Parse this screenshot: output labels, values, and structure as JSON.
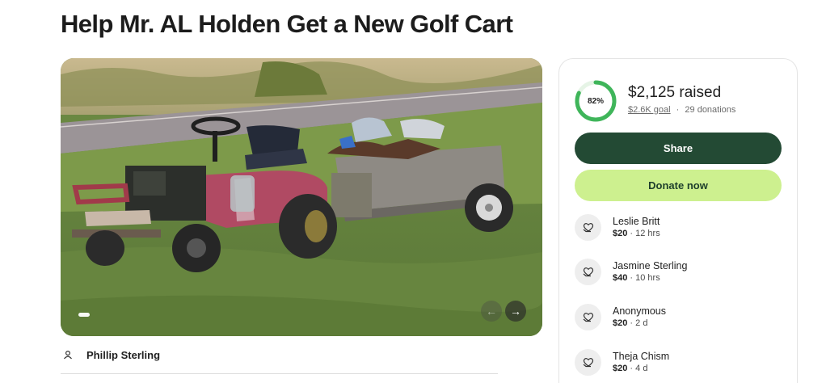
{
  "campaign": {
    "title": "Help Mr. AL Holden Get a New Golf Cart",
    "organizer": "Phillip Sterling"
  },
  "carousel": {
    "prev_icon": "←",
    "next_icon": "→",
    "slide_count_visible": 1
  },
  "progress": {
    "percent_label": "82%",
    "percent_value": 82,
    "raised": "$2,125 raised",
    "goal": "$2.6K goal",
    "separator": "·",
    "donations": "29 donations"
  },
  "actions": {
    "share_label": "Share",
    "donate_label": "Donate now"
  },
  "donations": [
    {
      "name": "Leslie Britt",
      "amount": "$20",
      "time": "12 hrs"
    },
    {
      "name": "Jasmine Sterling",
      "amount": "$40",
      "time": "10 hrs"
    },
    {
      "name": "Anonymous",
      "amount": "$20",
      "time": "2 d"
    },
    {
      "name": "Theja Chism",
      "amount": "$20",
      "time": "4 d"
    }
  ],
  "colors": {
    "brand_dark": "#234a34",
    "brand_light": "#cdf08f",
    "progress": "#3fb55a"
  },
  "icons": {
    "organizer": "person-icon",
    "donation": "heart-hand-icon"
  }
}
